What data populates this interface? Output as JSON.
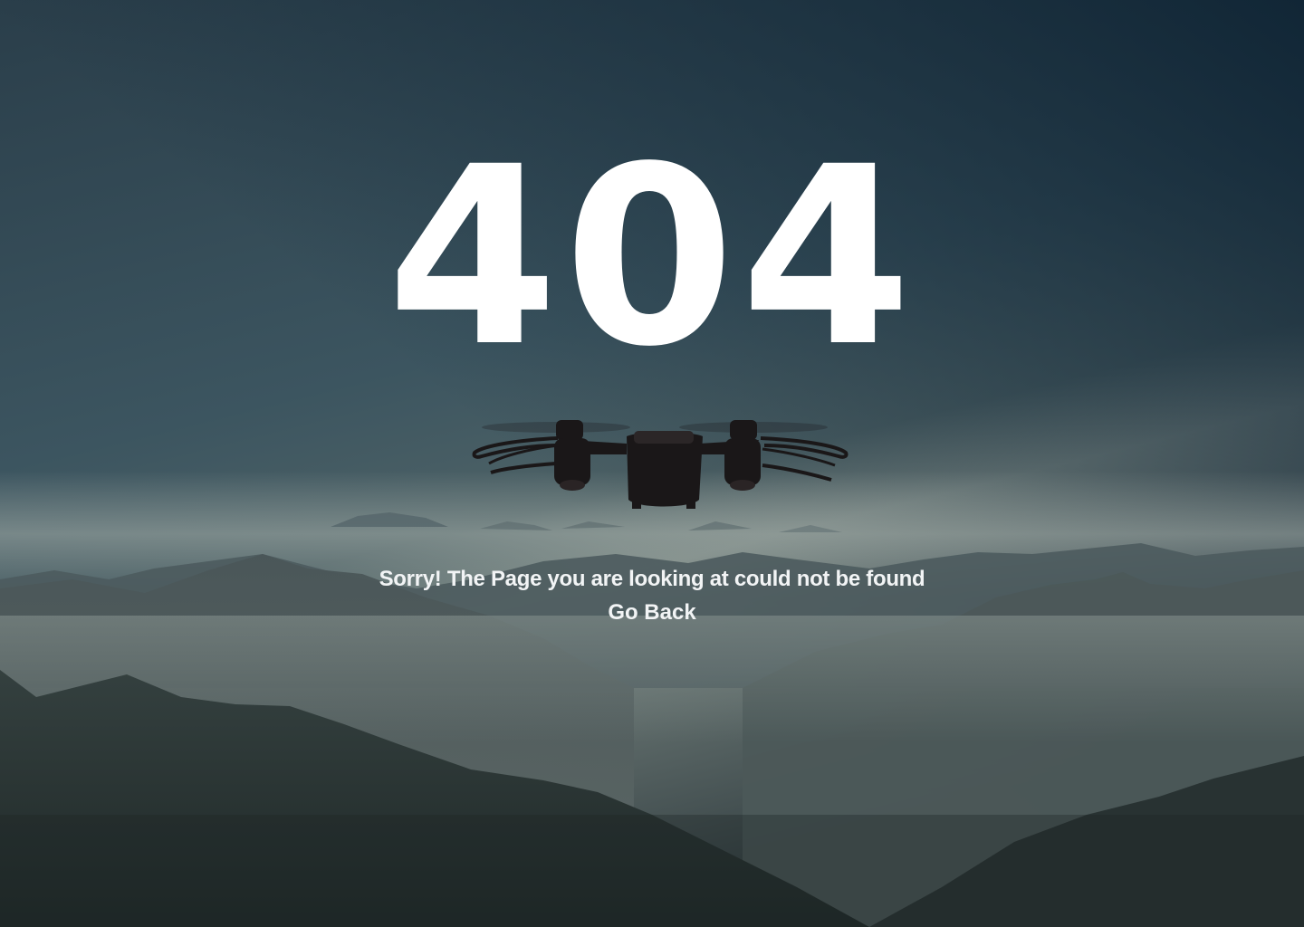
{
  "error": {
    "code": "404",
    "message": "Sorry! The Page you are looking at could not be found",
    "back_label": "Go Back"
  },
  "background": {
    "sky_top": "#1b2a38",
    "sky_mid": "#34505d",
    "haze": "#8c9a98",
    "mountain_far": "#4b5a5e",
    "mountain_mid": "#3a4749",
    "mountain_near": "#253031"
  },
  "colors": {
    "text": "#ffffff",
    "drone": "#1a1718"
  }
}
